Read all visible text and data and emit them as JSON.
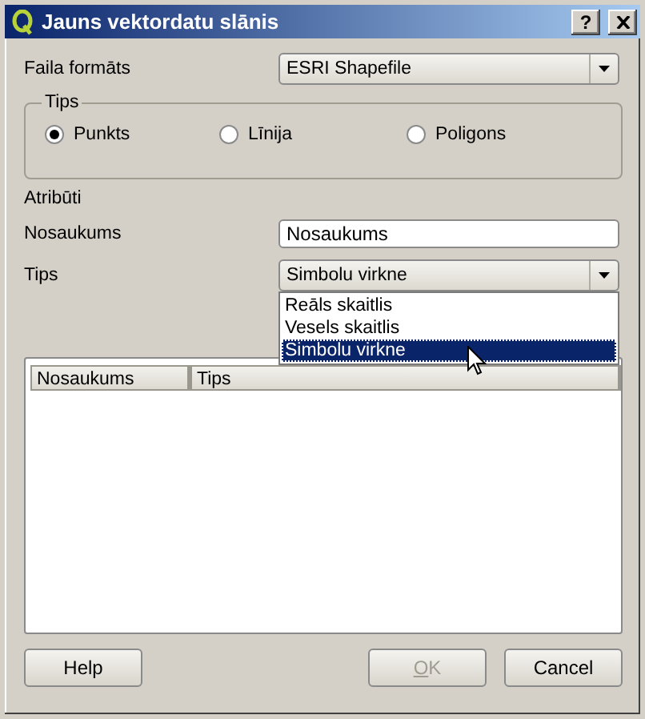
{
  "window": {
    "title": "Jauns vektordatu slānis",
    "help_button": "?"
  },
  "file_format": {
    "label": "Faila formāts",
    "value": "ESRI Shapefile"
  },
  "type_group": {
    "title": "Tips",
    "options": [
      {
        "label": "Punkts",
        "selected": true
      },
      {
        "label": "Līnija",
        "selected": false
      },
      {
        "label": "Poligons",
        "selected": false
      }
    ]
  },
  "attributes": {
    "title": "Atribūti",
    "name": {
      "label": "Nosaukums",
      "value": "Nosaukums"
    },
    "type": {
      "label": "Tips",
      "value": "Simbolu virkne",
      "expanded": true,
      "options": [
        {
          "label": "Reāls skaitlis",
          "selected": false
        },
        {
          "label": "Vesels skaitlis",
          "selected": false
        },
        {
          "label": "Simbolu virkne",
          "selected": true
        }
      ]
    }
  },
  "table": {
    "columns": [
      "Nosaukums",
      "Tips"
    ]
  },
  "buttons": [
    {
      "label": "Help",
      "disabled": false,
      "mnemonic": false
    },
    {
      "label": "OK",
      "disabled": true,
      "mnemonic": true
    },
    {
      "label": "Cancel",
      "disabled": false,
      "mnemonic": false
    }
  ]
}
